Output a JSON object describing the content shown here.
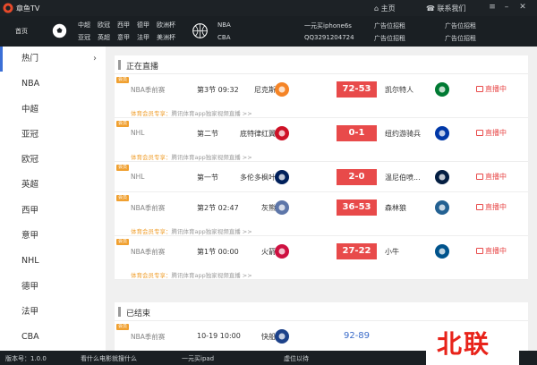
{
  "app": {
    "title": "章鱼TV",
    "home": "主页",
    "contact": "联系我们"
  },
  "nav": {
    "home": "首页",
    "soccer": [
      [
        "中超",
        "欧冠",
        "西甲",
        "德甲",
        "欧洲杯"
      ],
      [
        "亚冠",
        "英超",
        "意甲",
        "法甲",
        "美洲杯"
      ]
    ],
    "nba": "NBA",
    "cba": "CBA",
    "promo1": "一元买iphone6s",
    "promo2": "QQ3291204724",
    "ads": [
      "广告位招租",
      "广告位招租",
      "广告位招租",
      "广告位招租"
    ]
  },
  "sidebar": {
    "items": [
      "热门",
      "NBA",
      "中超",
      "亚冠",
      "欧冠",
      "英超",
      "西甲",
      "意甲",
      "NHL",
      "德甲",
      "法甲",
      "CBA"
    ]
  },
  "live_section": {
    "title": "正在直播"
  },
  "ended_section": {
    "title": "已结束"
  },
  "badge": "会员",
  "live_label": "直播中",
  "promo_prefix": "体育会员专享：",
  "promo_text": "腾讯体育app独家视频直播 >>",
  "live_games": [
    {
      "league": "NBA季前赛",
      "period": "第3节 09:32",
      "home": "尼克斯",
      "score": "72-53",
      "away": "凯尔特人",
      "promo": true,
      "home_color": "#f58426",
      "away_color": "#007a33"
    },
    {
      "league": "NHL",
      "period": "第二节",
      "home": "底特律红翼",
      "score": "0-1",
      "away": "纽约游骑兵",
      "promo": true,
      "home_color": "#ce1126",
      "away_color": "#0038a8"
    },
    {
      "league": "NHL",
      "period": "第一节",
      "home": "多伦多枫叶",
      "score": "2-0",
      "away": "温尼伯喷...",
      "promo": false,
      "home_color": "#00205b",
      "away_color": "#041e42"
    },
    {
      "league": "NBA季前赛",
      "period": "第2节 02:47",
      "home": "灰熊",
      "score": "36-53",
      "away": "森林狼",
      "promo": true,
      "home_color": "#5d76a9",
      "away_color": "#236192"
    },
    {
      "league": "NBA季前赛",
      "period": "第1节 00:00",
      "home": "火箭",
      "score": "27-22",
      "away": "小牛",
      "promo": true,
      "home_color": "#ce1141",
      "away_color": "#00538c"
    }
  ],
  "ended_games": [
    {
      "league": "NBA季前赛",
      "period": "10-19 10:00",
      "home": "快船",
      "score": "92-89",
      "home_color": "#1d428a"
    }
  ],
  "status": {
    "version": "版本号：1.0.0",
    "msg1": "看什么电影就搜什么",
    "msg2": "一元买ipad",
    "msg3": "虚位以待"
  },
  "watermark": "北联"
}
